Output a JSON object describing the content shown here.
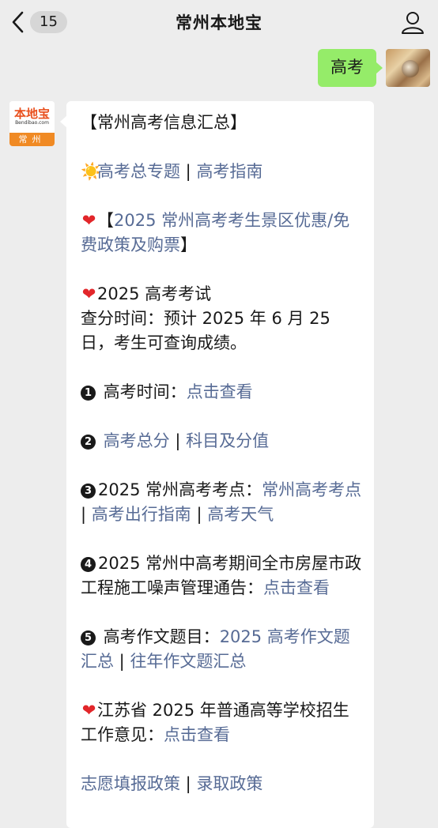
{
  "nav": {
    "unread_count": "15",
    "title": "常州本地宝",
    "back_icon": "chevron-left-icon",
    "profile_icon": "person-icon"
  },
  "outgoing": {
    "text": "高考"
  },
  "bot_avatar": {
    "logo": "本地宝",
    "url": "Bendibao.com",
    "city": "常州"
  },
  "message": {
    "header": "【常州高考信息汇总】",
    "line1": {
      "icon": "☀️",
      "link1": "高考总专题",
      "sep": " | ",
      "link2": "高考指南"
    },
    "line2": {
      "icon": "❤",
      "prefix": "【",
      "link": "2025 常州高考考生景区优惠/免费政策及购票",
      "suffix": "】"
    },
    "line3": {
      "icon": "❤",
      "title": "2025 高考考试",
      "body": "查分时间：预计 2025 年 6 月 25 日，考生可查询成绩。"
    },
    "item1": {
      "num": "1",
      "label": " 高考时间：",
      "link": "点击查看"
    },
    "item2": {
      "num": "2",
      "link1": " 高考总分",
      "sep": " | ",
      "link2": "科目及分值"
    },
    "item3": {
      "num": "3",
      "label": "2025 常州高考考点：",
      "link1": "常州高考考点",
      "sep1": " | ",
      "link2": "高考出行指南",
      "sep2": " | ",
      "link3": "高考天气"
    },
    "item4": {
      "num": "4",
      "label": "2025 常州中高考期间全市房屋市政工程施工噪声管理通告：",
      "link": "点击查看"
    },
    "item5": {
      "num": "5",
      "label": " 高考作文题目：",
      "link1": "2025 高考作文题汇总",
      "sep": " | ",
      "link2": "往年作文题汇总"
    },
    "line6": {
      "icon": "❤",
      "label": "江苏省 2025 年普通高等学校招生工作意见：",
      "link": "点击查看"
    },
    "line7": {
      "link1": "志愿填报政策",
      "sep": " | ",
      "link2": "录取政策"
    }
  },
  "colors": {
    "link": "#576b95",
    "outgoing_bubble": "#95ec69",
    "background": "#ededed"
  }
}
